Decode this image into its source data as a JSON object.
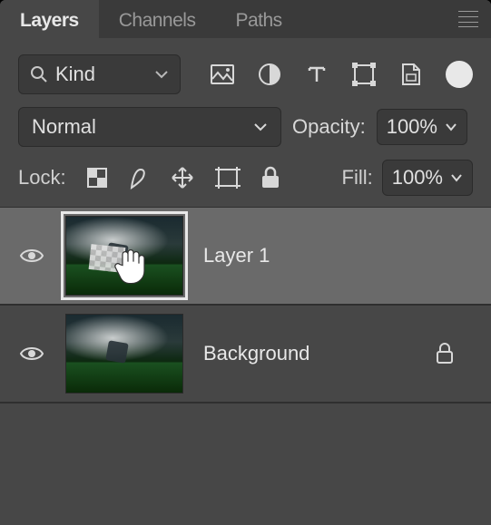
{
  "tabs": {
    "layers": "Layers",
    "channels": "Channels",
    "paths": "Paths"
  },
  "filter": {
    "kind_label": "Kind"
  },
  "blend": {
    "mode": "Normal",
    "opacity_label": "Opacity:",
    "opacity_value": "100%"
  },
  "lock": {
    "label": "Lock:",
    "fill_label": "Fill:",
    "fill_value": "100%"
  },
  "layers": [
    {
      "name": "Layer 1",
      "visible": true,
      "selected": true,
      "locked": false
    },
    {
      "name": "Background",
      "visible": true,
      "selected": false,
      "locked": true
    }
  ]
}
